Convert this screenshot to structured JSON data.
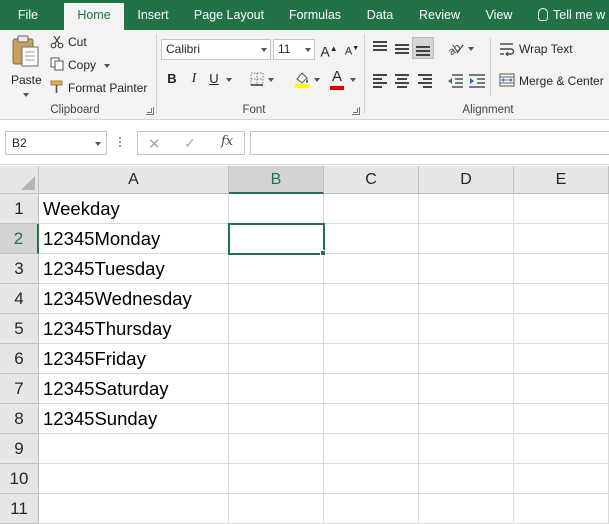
{
  "ribbon_tabs": [
    {
      "label": "File",
      "active": false
    },
    {
      "label": "Home",
      "active": true
    },
    {
      "label": "Insert",
      "active": false
    },
    {
      "label": "Page Layout",
      "active": false
    },
    {
      "label": "Formulas",
      "active": false
    },
    {
      "label": "Data",
      "active": false
    },
    {
      "label": "Review",
      "active": false
    },
    {
      "label": "View",
      "active": false
    },
    {
      "label": "Tell me w",
      "active": false
    }
  ],
  "clipboard": {
    "paste_label": "Paste",
    "cut_label": "Cut",
    "copy_label": "Copy",
    "format_painter_label": "Format Painter",
    "group_label": "Clipboard"
  },
  "font": {
    "font_name": "Calibri",
    "font_size": "11",
    "bold_label": "B",
    "italic_label": "I",
    "underline_label": "U",
    "font_color_letter": "A",
    "grow_label": "A",
    "shrink_label": "A",
    "group_label": "Font"
  },
  "alignment": {
    "wrap_text_label": "Wrap Text",
    "merge_center_label": "Merge & Center",
    "group_label": "Alignment"
  },
  "formula_bar": {
    "name_box": "B2",
    "fx_label": "fx",
    "cancel_symbol": "✕",
    "enter_symbol": "✓",
    "formula_value": ""
  },
  "sheet": {
    "columns": [
      "A",
      "B",
      "C",
      "D",
      "E"
    ],
    "selected_column": "B",
    "rows": [
      "1",
      "2",
      "3",
      "4",
      "5",
      "6",
      "7",
      "8",
      "9",
      "10",
      "11"
    ],
    "selected_row": "2",
    "active_cell": "B2",
    "column_a_values": [
      "Weekday",
      "12345Monday",
      "12345Tuesday",
      "12345Wednesday",
      "12345Thursday",
      "12345Friday",
      "12345Saturday",
      "12345Sunday",
      "",
      "",
      ""
    ]
  },
  "colors": {
    "accent": "#217346",
    "ribbon_bg": "#f3f3f3",
    "header_bg": "#e6e6e6",
    "grid_line": "#dadada"
  }
}
